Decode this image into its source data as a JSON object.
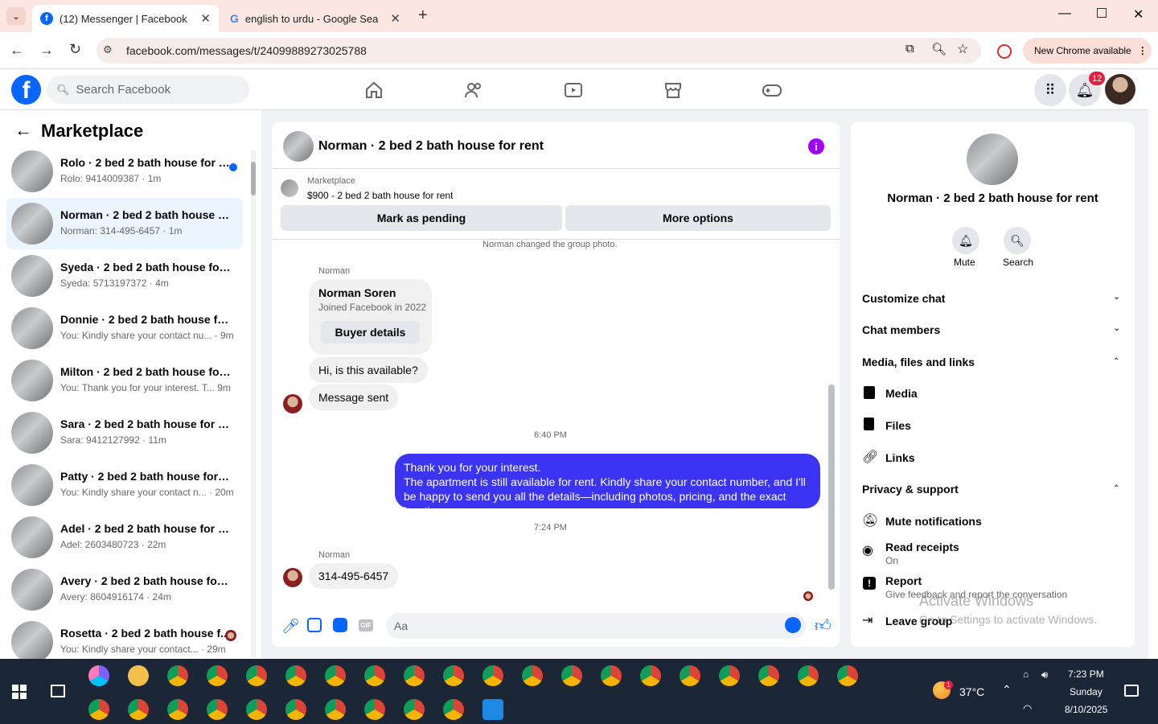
{
  "browser": {
    "tabs": [
      {
        "title": "(12) Messenger | Facebook"
      },
      {
        "title": "english to urdu - Google Search"
      }
    ],
    "url": "facebook.com/messages/t/24099889273025788",
    "new_chrome": "New Chrome available"
  },
  "fb": {
    "search_placeholder": "Search Facebook",
    "notif_count": "12"
  },
  "left": {
    "title": "Marketplace",
    "conversations": [
      {
        "title": "Rolo · 2 bed 2 bath house for r...",
        "sub": "Rolo: 9414009387 · 1m"
      },
      {
        "title": "Norman · 2 bed 2 bath house fo...",
        "sub": "Norman: 314-495-6457 · 1m"
      },
      {
        "title": "Syeda · 2 bed 2 bath house for r...",
        "sub": "Syeda: 5713197372 · 4m"
      },
      {
        "title": "Donnie · 2 bed 2 bath house for...",
        "sub": "You: Kindly share your contact nu...  · 9m"
      },
      {
        "title": "Milton · 2 bed 2 bath house for ...",
        "sub": "You: Thank you for your interest. T... 9m"
      },
      {
        "title": "Sara · 2 bed 2 bath house for rent",
        "sub": "Sara: 9412127992 · 11m"
      },
      {
        "title": "Patty · 2 bed 2 bath house for re...",
        "sub": "You: Kindly share your contact n...  · 20m"
      },
      {
        "title": "Adel · 2 bed 2 bath house for rent",
        "sub": "Adel: 2603480723 · 22m"
      },
      {
        "title": "Avery · 2 bed 2 bath house for r...",
        "sub": "Avery: 8604916174 · 24m"
      },
      {
        "title": "Rosetta · 2 bed 2 bath house f...",
        "sub": "You: Kindly share your contact... · 29m"
      }
    ]
  },
  "chat": {
    "title": "Norman · 2 bed 2 bath house for rent",
    "mp_label": "Marketplace",
    "mp_listing": "$900 - 2 bed 2 bath house for rent",
    "mark_pending": "Mark as pending",
    "more_options": "More options",
    "system_msg": "Norman changed the group photo.",
    "sender1": "Norman",
    "card_name": "Norman Soren",
    "card_sub": "Joined Facebook in 2022",
    "buyer_details": "Buyer details",
    "msg1": "Hi, is this available?",
    "msg2": "Message sent",
    "time1": "6:40 PM",
    "out_line1": "Thank you for your interest.",
    "out_line2": "The apartment is still available for rent. Kindly share your contact number, and I'll be happy to send you all the details—including photos, pricing, and the exact location.",
    "time2": "7:24 PM",
    "sender2": "Norman",
    "msg3": "314-495-6457",
    "input_placeholder": "Aa"
  },
  "right": {
    "title": "Norman · 2 bed 2 bath house for rent",
    "mute": "Mute",
    "search": "Search",
    "customize": "Customize chat",
    "members": "Chat members",
    "media_section": "Media, files and links",
    "media": "Media",
    "files": "Files",
    "links": "Links",
    "privacy": "Privacy & support",
    "mute_notif": "Mute notifications",
    "read_receipts": "Read receipts",
    "read_on": "On",
    "report": "Report",
    "report_sub": "Give feedback and report the conversation",
    "leave": "Leave group"
  },
  "watermark": {
    "line1": "Activate Windows",
    "line2": "Go to Settings to activate Windows."
  },
  "taskbar": {
    "weather": "37°C",
    "time": "7:23 PM",
    "day": "Sunday",
    "date": "8/10/2025",
    "weather_badge": "1"
  },
  "colors": {
    "fb_blue": "#0866ff",
    "out_bubble": "#3b34f4",
    "badge_red": "#e41e3f"
  }
}
